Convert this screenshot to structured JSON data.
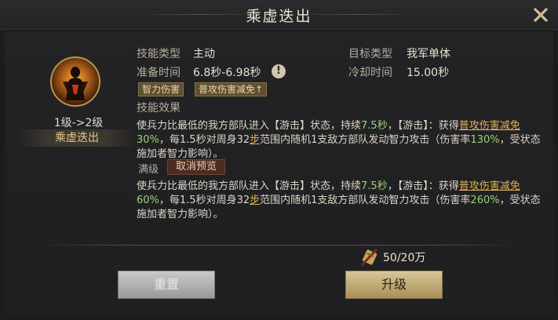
{
  "header": {
    "title": "乘虚迭出"
  },
  "skill": {
    "level_text": "1级->2级",
    "name": "乘虚迭出"
  },
  "stats": {
    "type_label": "技能类型",
    "type_value": "主动",
    "target_label": "目标类型",
    "target_value": "我军单体",
    "prep_label": "准备时间",
    "prep_value": "6.8秒-6.98秒",
    "cooldown_label": "冷却时间",
    "cooldown_value": "15.00秒",
    "info_glyph": "!"
  },
  "tags": [
    "智力伤害",
    "普攻伤害减免↑"
  ],
  "effect_heading": "技能效果",
  "desc_current": {
    "p1": "使兵力比最低的我方部队进入【游击】状态，持续",
    "dur": "7.5秒",
    "p2": "，【游击】：获得",
    "link": "普攻伤害减免",
    "pct": "30%",
    "p3": "，每1.5秒对周身32",
    "step": "步",
    "p4": "范围内随机1支敌方部队发动智力攻击（伤害率",
    "rate": "130%",
    "p5": "，受状态施加者智力影响）。"
  },
  "max_label": "满级",
  "cancel_preview": "取消预览",
  "desc_max": {
    "p1": "使兵力比最低的我方部队进入【游击】状态，持续",
    "dur": "7.5秒",
    "p2": "，【游击】：获得",
    "link": "普攻伤害减免",
    "pct": "60%",
    "p3": "，每1.5秒对周身32",
    "step": "步",
    "p4": "范围内随机1支敌方部队发动智力攻击（伤害率",
    "rate": "260%",
    "p5": "，受状态施加者智力影响）。"
  },
  "cost": {
    "text": "50/20万",
    "icon": "scroll-token-icon"
  },
  "buttons": {
    "reset": "重置",
    "upgrade": "升级"
  },
  "colors": {
    "gold": "#e2b25a",
    "green": "#9bd17d",
    "upgrade_btn": "#c7b27c"
  }
}
